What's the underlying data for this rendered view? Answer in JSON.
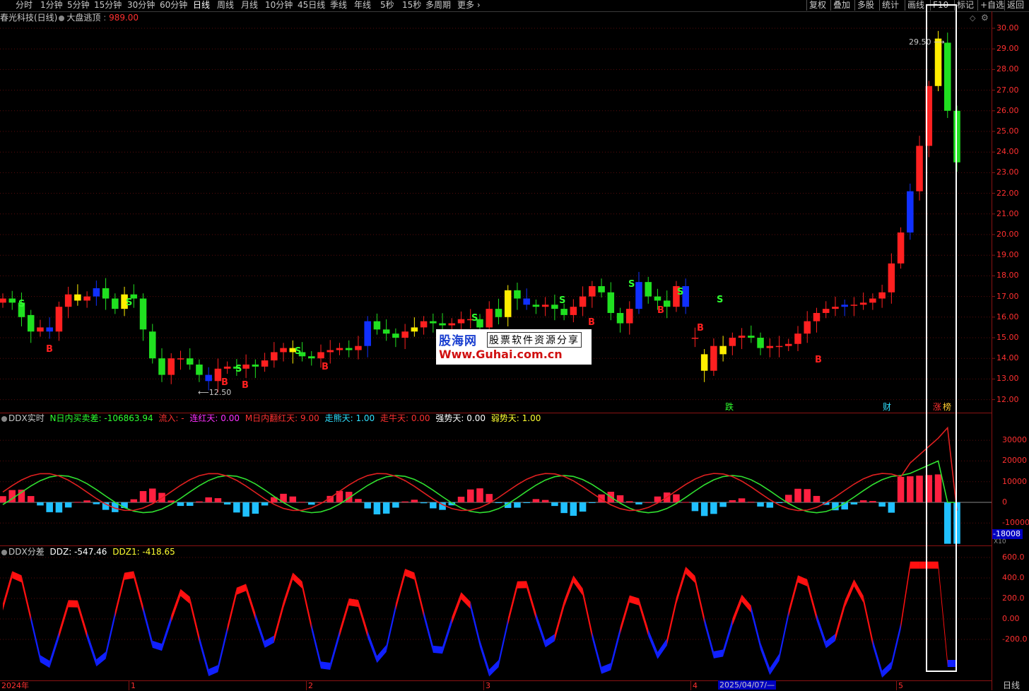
{
  "toolbar": {
    "periods": [
      {
        "label": "分时",
        "active": false
      },
      {
        "label": "1分钟",
        "active": false
      },
      {
        "label": "5分钟",
        "active": false
      },
      {
        "label": "15分钟",
        "active": false
      },
      {
        "label": "30分钟",
        "active": false
      },
      {
        "label": "60分钟",
        "active": false
      },
      {
        "label": "日线",
        "active": true
      },
      {
        "label": "周线",
        "active": false
      },
      {
        "label": "月线",
        "active": false
      },
      {
        "label": "10分钟",
        "active": false
      },
      {
        "label": "45日线",
        "active": false
      },
      {
        "label": "季线",
        "active": false
      },
      {
        "label": "年线",
        "active": false
      },
      {
        "label": "5秒",
        "active": false
      },
      {
        "label": "15秒",
        "active": false
      },
      {
        "label": "多周期",
        "active": false
      },
      {
        "label": "更多",
        "active": false
      }
    ],
    "tools": [
      "复权",
      "叠加",
      "多股",
      "统计",
      "画线",
      "F10",
      "标记",
      "+自选",
      "返回"
    ]
  },
  "main_panel": {
    "stock_name": "春光科技(日线)",
    "indicator_name": "大盘逃顶",
    "indicator_value": "989.00",
    "price_axis": [
      "30.00",
      "29.00",
      "28.00",
      "27.00",
      "26.00",
      "25.00",
      "24.00",
      "23.00",
      "22.00",
      "21.00",
      "20.00",
      "19.00",
      "18.00",
      "17.00",
      "16.00",
      "15.00",
      "14.00",
      "13.00",
      "12.00"
    ],
    "high_annotation": "29.50",
    "low_annotation": "12.50",
    "event_tags": [
      "跌",
      "财",
      "涨",
      "榜"
    ],
    "signal_buy": "B",
    "signal_sell": "S"
  },
  "watermark": {
    "logo": "股海网",
    "slogan": "股票软件资源分享",
    "url": "Www.Guhai.com.cn"
  },
  "ddx_panel": {
    "name": "DDX实时",
    "fields": [
      {
        "label": "N日内买卖差:",
        "value": "-106863.94",
        "color": "#30ff30"
      },
      {
        "label": "流入:",
        "value": "-",
        "color": "#ff3030"
      },
      {
        "label": "连红天:",
        "value": "0.00",
        "color": "#ff30ff"
      },
      {
        "label": "M日内翻红天:",
        "value": "9.00",
        "color": "#ff3030"
      },
      {
        "label": "走熊天:",
        "value": "1.00",
        "color": "#30e0ff"
      },
      {
        "label": "走牛天:",
        "value": "0.00",
        "color": "#ff3030"
      },
      {
        "label": "强势天:",
        "value": "0.00",
        "color": "#ffffff"
      },
      {
        "label": "弱势天:",
        "value": "1.00",
        "color": "#ffff30"
      }
    ],
    "axis": [
      "30000",
      "20000",
      "10000",
      "0",
      "-10000"
    ],
    "current_value": "-18008",
    "unit": "X10"
  },
  "ddz_panel": {
    "name": "DDX分差",
    "fields": [
      {
        "label": "DDZ:",
        "value": "-547.46",
        "color": "#ffffff"
      },
      {
        "label": "DDZ1:",
        "value": "-418.65",
        "color": "#ffff30"
      }
    ],
    "axis": [
      "600.0",
      "400.0",
      "200.0",
      "0.00",
      "-200.0"
    ]
  },
  "x_axis": {
    "labels": [
      "2024年",
      "1",
      "2",
      "3",
      "4",
      "5"
    ],
    "cursor_date": "2025/04/07/—",
    "period": "日线"
  },
  "colors": {
    "up": "#ff2020",
    "down": "#20e020",
    "blue": "#1030ff",
    "yellow": "#ffee00",
    "grid": "#8a1212"
  }
}
